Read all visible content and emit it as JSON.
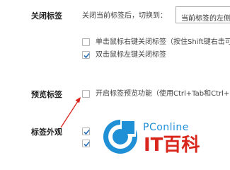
{
  "tab_close": {
    "label": "关闭标签",
    "switch_text": "关闭当前标签后，切换到：",
    "switch_select_value": "当前标签的左侧",
    "options": [
      {
        "label": "单击鼠标右键关闭标签（按住Shift键右击可",
        "checked": false
      },
      {
        "label": "双击鼠标左键关闭标签",
        "checked": true
      }
    ]
  },
  "tab_preview": {
    "label": "预览标签",
    "option": {
      "label": "开启标签预览功能（使用Ctrl+Tab和Ctrl+",
      "checked": false
    }
  },
  "tab_appearance": {
    "label": "标签外观",
    "options": [
      {
        "checked": true
      },
      {
        "checked": true
      }
    ]
  },
  "watermark": {
    "brand": "PConline",
    "name": "IT百科",
    "colors": {
      "blue": "#1f8fd6",
      "red": "#d9261c"
    }
  },
  "colors": {
    "arrow": "#d9261c",
    "check": "#2a6fb8"
  }
}
